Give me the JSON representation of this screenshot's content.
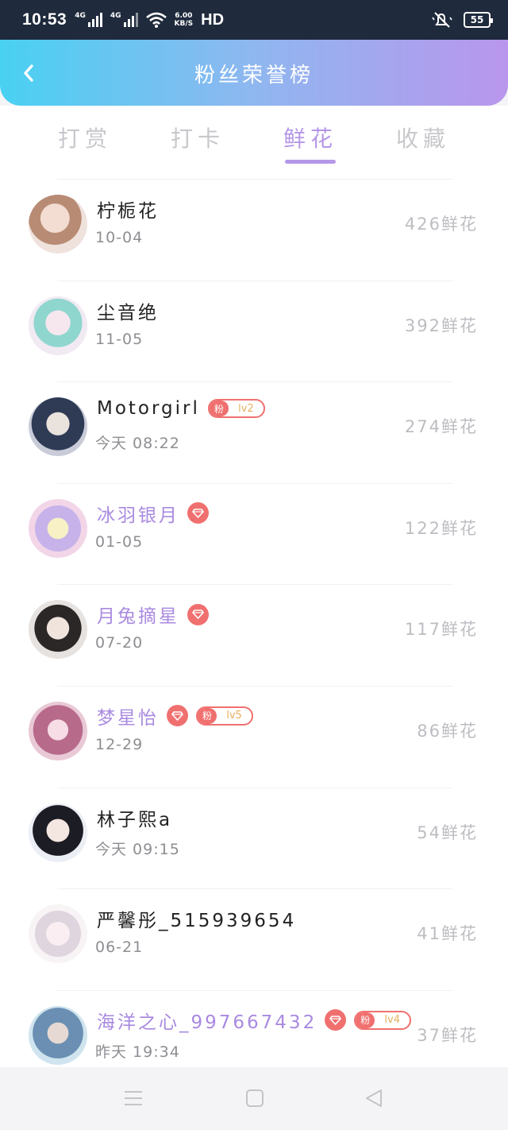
{
  "status_bar": {
    "time": "10:53",
    "signal1_tag": "4G",
    "signal2_tag": "4G",
    "speed_value": "6.00",
    "speed_unit": "KB/S",
    "hd_label": "HD",
    "battery": "55",
    "icons": [
      "signal-icon",
      "wifi-icon",
      "mute-icon",
      "battery-icon"
    ]
  },
  "header": {
    "title": "粉丝荣誉榜",
    "back_icon": "chevron-left-icon"
  },
  "tabs": [
    {
      "label": "打赏",
      "active": false
    },
    {
      "label": "打卡",
      "active": false
    },
    {
      "label": "鲜花",
      "active": true
    },
    {
      "label": "收藏",
      "active": false
    }
  ],
  "entries": [
    {
      "name": "柠栀花",
      "date": "10-04",
      "count": "426鲜花",
      "vip": false,
      "diamond": false,
      "fan_level": null
    },
    {
      "name": "尘音绝",
      "date": "11-05",
      "count": "392鲜花",
      "vip": false,
      "diamond": false,
      "fan_level": null
    },
    {
      "name": "Motorgirl",
      "date": "今天 08:22",
      "count": "274鲜花",
      "vip": false,
      "diamond": false,
      "fan_level": "lv2"
    },
    {
      "name": "冰羽银月",
      "date": "01-05",
      "count": "122鲜花",
      "vip": true,
      "diamond": true,
      "fan_level": null
    },
    {
      "name": "月兔摘星",
      "date": "07-20",
      "count": "117鲜花",
      "vip": true,
      "diamond": true,
      "fan_level": null
    },
    {
      "name": "梦星怡",
      "date": "12-29",
      "count": "86鲜花",
      "vip": true,
      "diamond": true,
      "fan_level": "lv5"
    },
    {
      "name": "林子熙a",
      "date": "今天 09:15",
      "count": "54鲜花",
      "vip": false,
      "diamond": false,
      "fan_level": null
    },
    {
      "name": "严馨彤_515939654",
      "date": "06-21",
      "count": "41鲜花",
      "vip": false,
      "diamond": false,
      "fan_level": null
    },
    {
      "name": "海洋之心_997667432",
      "date": "昨天 19:34",
      "count": "37鲜花",
      "vip": true,
      "diamond": true,
      "fan_level": "lv4"
    }
  ],
  "fan_badge_label": "粉",
  "colors": {
    "accent": "#b597e8",
    "vip_name": "#a98ae0",
    "badge": "#f0706f",
    "header_gradient_start": "#49d1f2",
    "header_gradient_end": "#b996ec"
  },
  "nav": {
    "icons": [
      "menu-icon",
      "home-square-icon",
      "back-triangle-icon"
    ]
  }
}
